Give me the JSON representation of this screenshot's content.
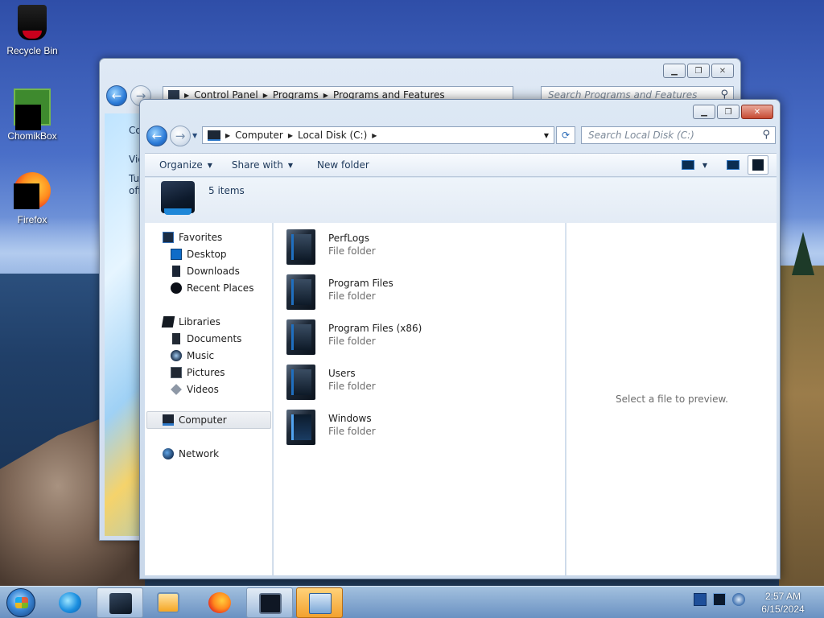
{
  "desktop": {
    "icons": [
      {
        "label": "Recycle Bin",
        "icon": "recycle-bin-icon"
      },
      {
        "label": "ChomikBox",
        "icon": "chomikbox-icon"
      },
      {
        "label": "Firefox",
        "icon": "firefox-icon"
      }
    ]
  },
  "back_window": {
    "breadcrumbs": [
      "Control Panel",
      "Programs",
      "Programs and Features"
    ],
    "search_placeholder": "Search Programs and Features",
    "body_lines": [
      "Co",
      "Vie",
      "Tu",
      "off"
    ]
  },
  "explorer": {
    "breadcrumbs": [
      "Computer",
      "Local Disk (C:)"
    ],
    "search_placeholder": "Search Local Disk (C:)",
    "toolbar": {
      "organize": "Organize",
      "share_with": "Share with",
      "new_folder": "New folder"
    },
    "items_count": "5 items",
    "nav": {
      "favorites": "Favorites",
      "desktop": "Desktop",
      "downloads": "Downloads",
      "recent_places": "Recent Places",
      "libraries": "Libraries",
      "documents": "Documents",
      "music": "Music",
      "pictures": "Pictures",
      "videos": "Videos",
      "computer": "Computer",
      "network": "Network"
    },
    "files": [
      {
        "name": "PerfLogs",
        "type": "File folder"
      },
      {
        "name": "Program Files",
        "type": "File folder"
      },
      {
        "name": "Program Files (x86)",
        "type": "File folder"
      },
      {
        "name": "Users",
        "type": "File folder"
      },
      {
        "name": "Windows",
        "type": "File folder"
      }
    ],
    "preview_text": "Select a file to preview."
  },
  "taskbar": {
    "time": "2:57 AM",
    "date": "6/15/2024"
  }
}
